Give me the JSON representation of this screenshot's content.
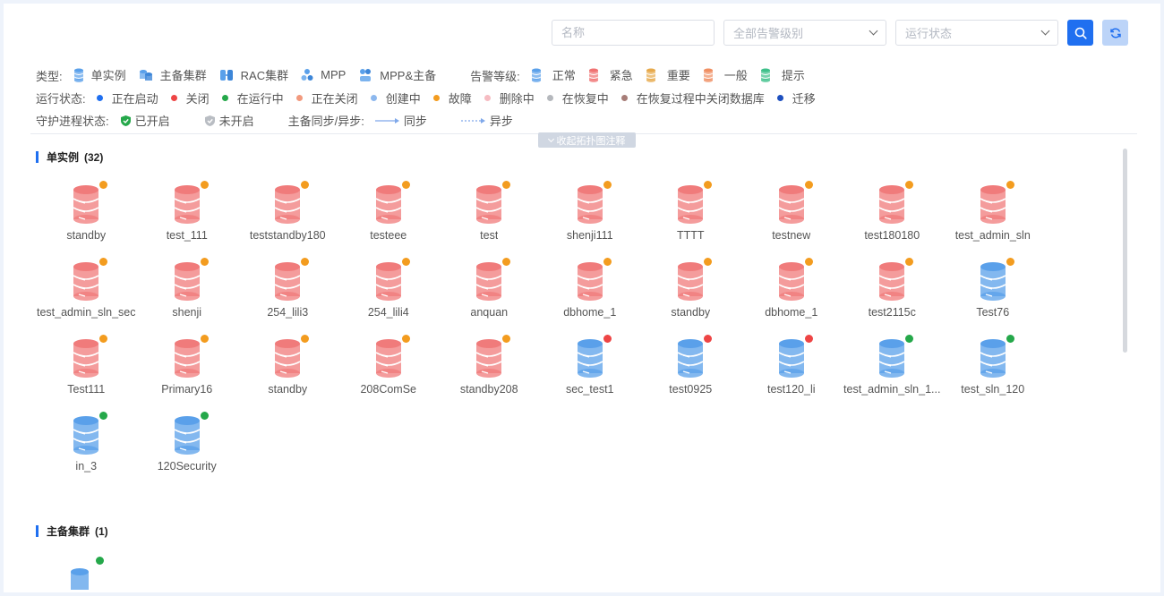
{
  "toolbar": {
    "name_placeholder": "名称",
    "alarm_placeholder": "全部告警级别",
    "status_placeholder": "运行状态"
  },
  "legend": {
    "type_label": "类型:",
    "types": [
      {
        "label": "单实例",
        "icon": "single-instance-icon"
      },
      {
        "label": "主备集群",
        "icon": "primary-standby-cluster-icon"
      },
      {
        "label": "RAC集群",
        "icon": "rac-cluster-icon"
      },
      {
        "label": "MPP",
        "icon": "mpp-icon"
      },
      {
        "label": "MPP&主备",
        "icon": "mpp-primary-standby-icon"
      }
    ],
    "alarm_label": "告警等级:",
    "alarms": [
      {
        "label": "正常",
        "color": "#5aa0ea"
      },
      {
        "label": "紧急",
        "color": "#f07272"
      },
      {
        "label": "重要",
        "color": "#e7a94b"
      },
      {
        "label": "一般",
        "color": "#f08f62"
      },
      {
        "label": "提示",
        "color": "#3ec08a"
      }
    ],
    "run_label": "运行状态:",
    "run_states": [
      {
        "label": "正在启动",
        "color": "#1f6ff0"
      },
      {
        "label": "关闭",
        "color": "#ee4545"
      },
      {
        "label": "在运行中",
        "color": "#25a84a"
      },
      {
        "label": "正在关闭",
        "color": "#f29a7e"
      },
      {
        "label": "创建中",
        "color": "#8db8ee"
      },
      {
        "label": "故障",
        "color": "#f39c1f"
      },
      {
        "label": "删除中",
        "color": "#f6bcc2"
      },
      {
        "label": "在恢复中",
        "color": "#b5b8bd"
      },
      {
        "label": "在恢复过程中关闭数据库",
        "color": "#a77d78"
      },
      {
        "label": "迁移",
        "color": "#1d4fbf"
      }
    ],
    "guard_label": "守护进程状态:",
    "guard_on": "已开启",
    "guard_off": "未开启",
    "sync_label": "主备同步/异步:",
    "sync": "同步",
    "async": "异步",
    "collapse_label": "收起拓扑图注释"
  },
  "sections": {
    "single": {
      "title": "单实例",
      "count": "(32)"
    },
    "cluster": {
      "title": "主备集群",
      "count": "(1)"
    }
  },
  "colors": {
    "red_db": "#f07b7b",
    "blue_db": "#5aa0ea",
    "status_fault": "#f39c1f",
    "status_closed": "#ee4545",
    "status_running": "#25a84a"
  },
  "nodes": [
    {
      "name": "standby",
      "db": "red",
      "status": "fault"
    },
    {
      "name": "test_111",
      "db": "red",
      "status": "fault"
    },
    {
      "name": "teststandby180",
      "db": "red",
      "status": "fault"
    },
    {
      "name": "testeee",
      "db": "red",
      "status": "fault"
    },
    {
      "name": "test",
      "db": "red",
      "status": "fault"
    },
    {
      "name": "shenji111",
      "db": "red",
      "status": "fault"
    },
    {
      "name": "TTTT",
      "db": "red",
      "status": "fault"
    },
    {
      "name": "testnew",
      "db": "red",
      "status": "fault"
    },
    {
      "name": "test180180",
      "db": "red",
      "status": "fault"
    },
    {
      "name": "test_admin_sln",
      "db": "red",
      "status": "fault"
    },
    {
      "name": "test_admin_sln_sec",
      "db": "red",
      "status": "fault"
    },
    {
      "name": "shenji",
      "db": "red",
      "status": "fault"
    },
    {
      "name": "254_lili3",
      "db": "red",
      "status": "fault"
    },
    {
      "name": "254_lili4",
      "db": "red",
      "status": "fault"
    },
    {
      "name": "anquan",
      "db": "red",
      "status": "fault"
    },
    {
      "name": "dbhome_1",
      "db": "red",
      "status": "fault"
    },
    {
      "name": "standby",
      "db": "red",
      "status": "fault"
    },
    {
      "name": "dbhome_1",
      "db": "red",
      "status": "fault"
    },
    {
      "name": "test2115c",
      "db": "red",
      "status": "fault"
    },
    {
      "name": "Test76",
      "db": "blue",
      "status": "fault"
    },
    {
      "name": "Test111",
      "db": "red",
      "status": "fault"
    },
    {
      "name": "Primary16",
      "db": "red",
      "status": "fault"
    },
    {
      "name": "standby",
      "db": "red",
      "status": "fault"
    },
    {
      "name": "208ComSe",
      "db": "red",
      "status": "fault"
    },
    {
      "name": "standby208",
      "db": "red",
      "status": "fault"
    },
    {
      "name": "sec_test1",
      "db": "blue",
      "status": "closed"
    },
    {
      "name": "test0925",
      "db": "blue",
      "status": "closed"
    },
    {
      "name": "test120_li",
      "db": "blue",
      "status": "closed"
    },
    {
      "name": "test_admin_sln_1...",
      "db": "blue",
      "status": "running"
    },
    {
      "name": "test_sln_120",
      "db": "blue",
      "status": "running"
    },
    {
      "name": "in_3",
      "db": "blue",
      "status": "running"
    },
    {
      "name": "120Security",
      "db": "blue",
      "status": "running"
    }
  ],
  "cluster_nodes": [
    {
      "db": "blue",
      "status": "running"
    }
  ]
}
